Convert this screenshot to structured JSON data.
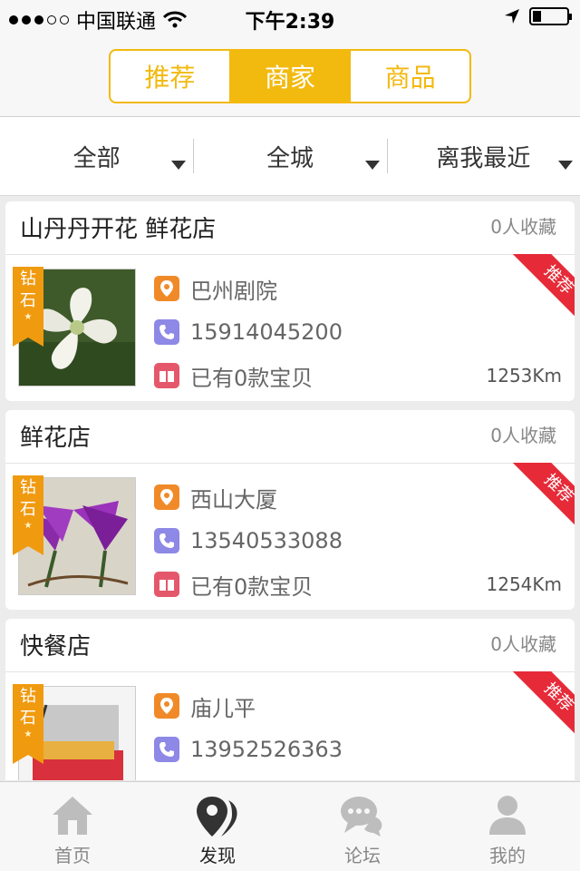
{
  "status": {
    "carrier": "中国联通",
    "time": "下午2:39",
    "battery_level": 0.25
  },
  "segments": [
    {
      "label": "推荐",
      "active": false
    },
    {
      "label": "商家",
      "active": true
    },
    {
      "label": "商品",
      "active": false
    }
  ],
  "filters": [
    {
      "label": "全部"
    },
    {
      "label": "全城"
    },
    {
      "label": "离我最近"
    }
  ],
  "stores": [
    {
      "name": "山丹丹开花 鲜花店",
      "fav": "0人收藏",
      "badge": "钻石",
      "ribbon": "推荐",
      "location": "巴州剧院",
      "phone": "15914045200",
      "goods": "已有0款宝贝",
      "distance": "1253Km"
    },
    {
      "name": "鲜花店",
      "fav": "0人收藏",
      "badge": "钻石",
      "ribbon": "推荐",
      "location": "西山大厦",
      "phone": "13540533088",
      "goods": "已有0款宝贝",
      "distance": "1254Km"
    },
    {
      "name": "快餐店",
      "fav": "0人收藏",
      "badge": "钻石",
      "ribbon": "推荐",
      "location": "庙儿平",
      "phone": "13952526363",
      "goods": "",
      "distance": ""
    }
  ],
  "tabs": [
    {
      "label": "首页",
      "icon": "home-icon"
    },
    {
      "label": "发现",
      "icon": "discover-pin-icon"
    },
    {
      "label": "论坛",
      "icon": "chat-bubble-icon"
    },
    {
      "label": "我的",
      "icon": "user-icon"
    }
  ],
  "colors": {
    "accent": "#f2b90f",
    "ribbon": "#e62a38",
    "badge": "#f09a10"
  }
}
